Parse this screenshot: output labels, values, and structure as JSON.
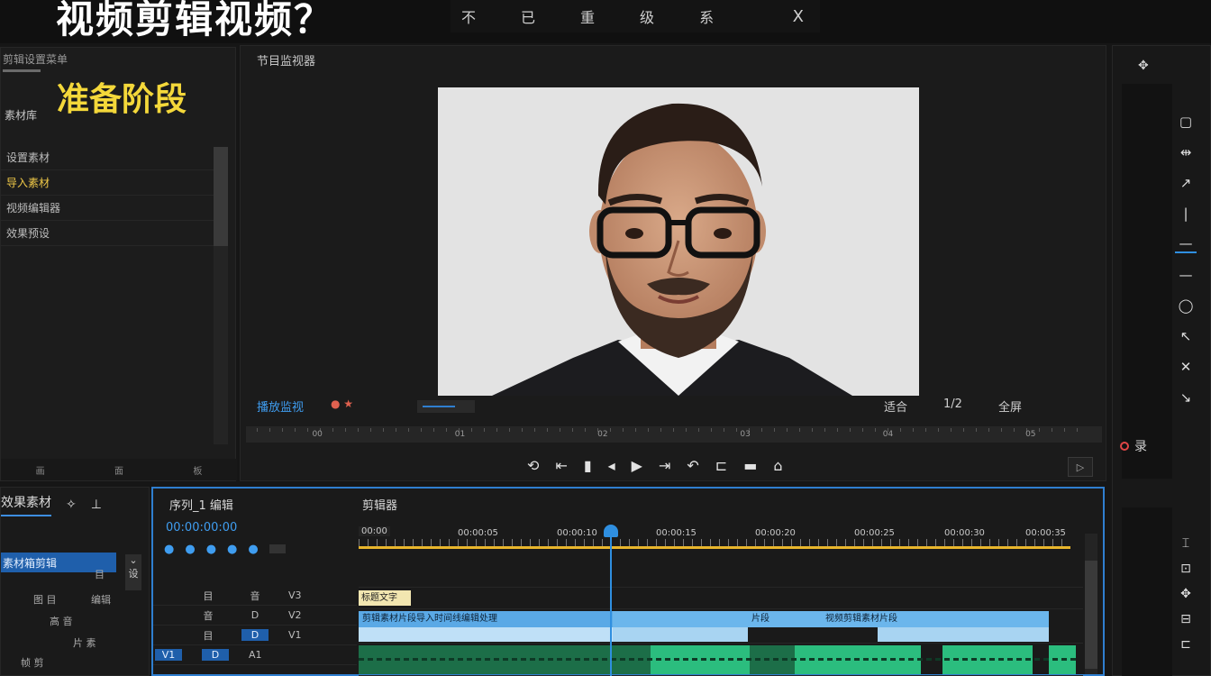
{
  "header": {
    "headline": "视频剪辑视频？",
    "menu": [
      "不",
      "已",
      "重",
      "级",
      "系"
    ],
    "close": "X"
  },
  "left_panel": {
    "title": "剪辑设置菜单",
    "stage_title": "准备阶段",
    "tab": "素材库",
    "items": [
      {
        "label": "设置素材",
        "active": false
      },
      {
        "label": "导入素材",
        "active": true
      },
      {
        "label": "视频编辑器",
        "active": false
      },
      {
        "label": "效果预设",
        "active": false
      }
    ],
    "footer": [
      "画",
      "面",
      "板"
    ]
  },
  "monitor": {
    "title": "节目监视器",
    "left_label": "播放监视",
    "right_labels": [
      "适合",
      "1/2",
      "全屏"
    ],
    "scrub_labels": [
      "00",
      "01",
      "02",
      "03",
      "04",
      "05"
    ],
    "transport": [
      "⟲",
      "⇤",
      "▮",
      "◂",
      "▶",
      "⇥",
      "↶",
      "⊏",
      "▬",
      "⌂"
    ],
    "export_icon": "▷"
  },
  "right_toolbar": {
    "top_icon": "✥",
    "tools": [
      "▢",
      "⇹",
      "↗",
      "|",
      "—",
      "—",
      "◯",
      "↖",
      "✕",
      "↘"
    ],
    "active_index": 4,
    "record_label": "录",
    "tools2": [
      "⌶",
      "⊡",
      "✥",
      "⊟",
      "⊏"
    ]
  },
  "project": {
    "tabs": [
      "效果素材",
      "✧",
      "⊥"
    ],
    "selected": "素材箱剪辑",
    "dropdown": [
      "⌄",
      "设"
    ],
    "rows": [
      "目",
      "图 目",
      "编辑",
      "高 音",
      "片 素",
      "帧 剪"
    ]
  },
  "timeline": {
    "title": "序列_1 编辑",
    "sequence_name": "剪辑器",
    "timecode": "00:00:00:00",
    "tool_icons": [
      "●",
      "●",
      "●",
      "●",
      "●"
    ],
    "first_timecode": "00:00",
    "ruler_labels": [
      "00:00:05",
      "00:00:10",
      "00:00:15",
      "00:00:20",
      "00:00:25",
      "00:00:30",
      "00:00:35"
    ],
    "track_heads": [
      {
        "a": "目",
        "b": "音",
        "c": "V3"
      },
      {
        "a": "音",
        "b": "D",
        "c": "V2"
      },
      {
        "a": "目",
        "b": "D",
        "c": "V1"
      },
      {
        "a": "V1",
        "b": "D",
        "c": "A1"
      }
    ],
    "title_clip_label": "标题文字",
    "v2_label_1": "剪辑素材片段导入时间线编辑处理",
    "v2_label_2": "片段",
    "v2_label_3": "视频剪辑素材片段"
  },
  "colors": {
    "accent_blue": "#2f8fe0",
    "yellow": "#f4d83a",
    "green": "#1c8a5a",
    "light_blue": "#a8d4f2"
  }
}
